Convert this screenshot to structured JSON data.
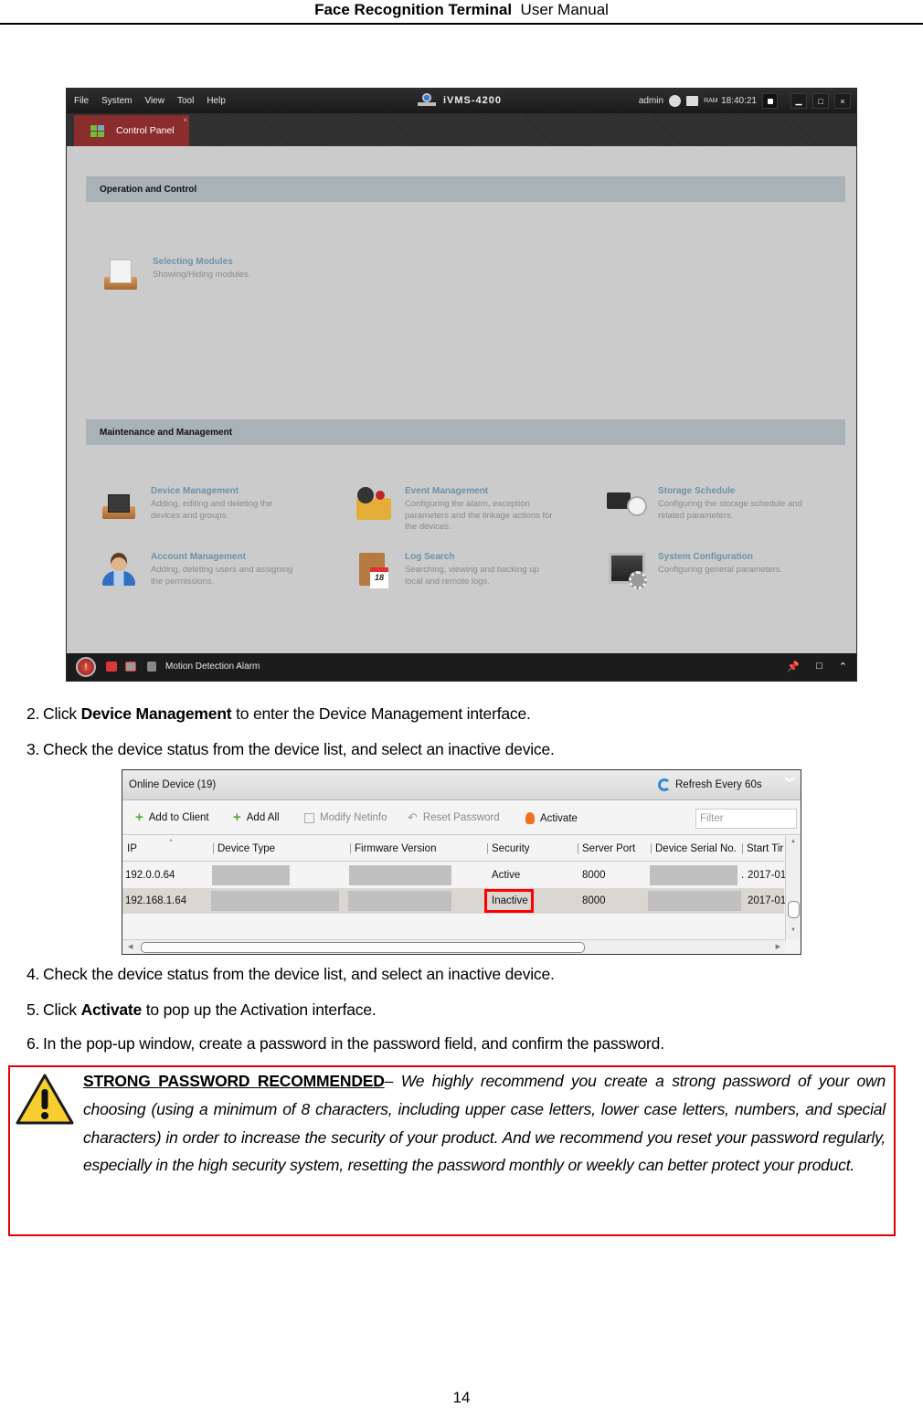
{
  "page_header": {
    "title_bold": "Face Recognition Terminal",
    "title_regular": "User Manual"
  },
  "ivms": {
    "menu": [
      "File",
      "System",
      "View",
      "Tool",
      "Help"
    ],
    "app_title": "iVMS-4200",
    "user": "admin",
    "clock": "18:40:21",
    "status_icons": [
      "network-icon",
      "cpu-icon",
      "ram-icon"
    ],
    "ram_label": "RAM",
    "window_buttons": {
      "minimize": "▁",
      "maximize": "□",
      "close": "×"
    },
    "tab": {
      "label": "Control Panel",
      "close": "×"
    },
    "sections": [
      {
        "title": "Operation and Control",
        "modules": [
          {
            "title": "Selecting Modules",
            "desc": [
              "Showing/Hiding modules."
            ],
            "icon": "selecting-modules-icon"
          }
        ]
      },
      {
        "title": "Maintenance and Management",
        "modules": [
          {
            "title": "Device Management",
            "desc": [
              "Adding, editing and deleting the",
              "devices and groups."
            ],
            "icon": "device-management-icon"
          },
          {
            "title": "Event Management",
            "desc": [
              "Configuring the alarm, exception",
              "parameters and the linkage actions for",
              "the devices."
            ],
            "icon": "event-management-icon"
          },
          {
            "title": "Storage Schedule",
            "desc": [
              "Configuring the storage schedule and",
              "related parameters."
            ],
            "icon": "storage-schedule-icon"
          },
          {
            "title": "Account Management",
            "desc": [
              "Adding, deleting users and assigning",
              "the permissions."
            ],
            "icon": "account-management-icon"
          },
          {
            "title": "Log Search",
            "desc": [
              "Searching, viewing and backing up",
              "local and remote logs."
            ],
            "icon": "log-search-icon"
          },
          {
            "title": "System Configuration",
            "desc": [
              "Configuring general parameters."
            ],
            "icon": "system-configuration-icon"
          }
        ]
      }
    ],
    "footer": {
      "alarm_label": "Motion Detection Alarm",
      "right_icons": [
        "pin-icon",
        "window-icon",
        "expand-up-icon"
      ]
    }
  },
  "steps": [
    {
      "num": "2.",
      "pre": "Click ",
      "bold": "Device Management",
      "post": " to enter the Device Management interface."
    },
    {
      "num": "3.",
      "pre": "Check the device status from the device list, and select an inactive device.",
      "bold": "",
      "post": ""
    },
    {
      "num": "4.",
      "pre": "Check the device status from the device list, and select an inactive device.",
      "bold": "",
      "post": ""
    },
    {
      "num": "5.",
      "pre": "Click ",
      "bold": "Activate",
      "post": " to pop up the Activation interface."
    },
    {
      "num": "6.",
      "pre": "In the pop-up window, create a password in the password field, and confirm the password.",
      "bold": "",
      "post": ""
    }
  ],
  "device_list": {
    "title": "Online Device (19)",
    "refresh_label": "Refresh Every 60s",
    "toolbar": {
      "add_to_client": "Add to Client",
      "add_all": "Add All",
      "modify_netinfo": "Modify Netinfo",
      "reset_password": "Reset Password",
      "activate": "Activate"
    },
    "filter_placeholder": "Filter",
    "columns": [
      "IP",
      "Device Type",
      "Firmware Version",
      "Security",
      "Server Port",
      "Device Serial No.",
      "Start Tir"
    ],
    "rows": [
      {
        "ip": "192.0.0.64",
        "security": "Active",
        "port": "8000",
        "serial_suffix": ".",
        "start_time": "2017-01",
        "selected": false
      },
      {
        "ip": "192.168.1.64",
        "security": "Inactive",
        "port": "8000",
        "serial_suffix": "",
        "start_time": "2017-01",
        "selected": true
      }
    ],
    "highlight_color": "#ff0000"
  },
  "warning": {
    "heading": "STRONG PASSWORD RECOMMENDED",
    "dash": "– ",
    "body": "We highly recommend you create a strong password of your own choosing (using a minimum of 8 characters, including upper case letters, lower case letters, numbers, and special characters) in order to increase the security of your product. And we recommend you reset your password regularly, especially in the high security system, resetting the password monthly or weekly can better protect your product.",
    "border_color": "#e00000"
  },
  "page_number": "14"
}
